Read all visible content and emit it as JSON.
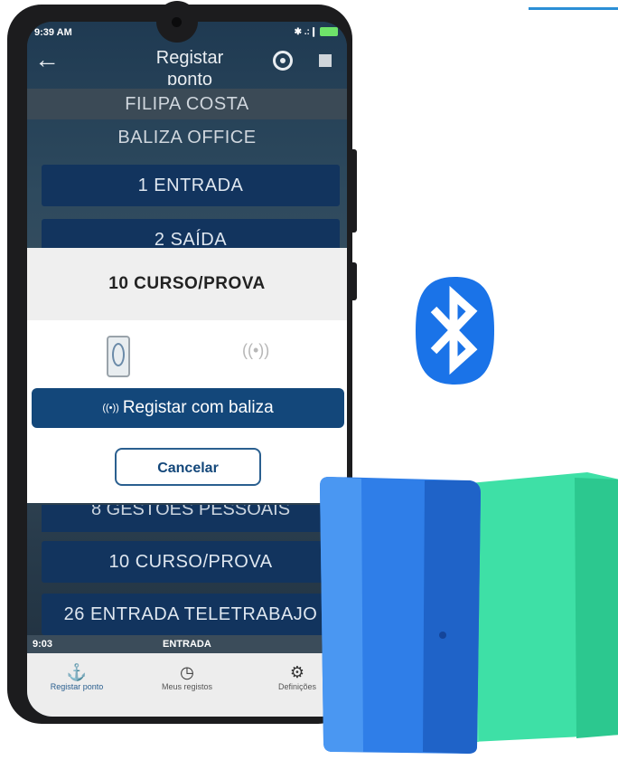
{
  "status": {
    "time": "9:39 AM",
    "signal": "✱ .:❙"
  },
  "appbar": {
    "title": "Registar ponto",
    "back_icon": "arrow-left-icon"
  },
  "employee": {
    "name": "FILIPA COSTA",
    "location": "BALIZA OFFICE"
  },
  "menu": {
    "items": [
      "1  ENTRADA",
      "2  SAÍDA"
    ],
    "partial_item": "8  GESTÕES PESSOAIS",
    "lower_items": [
      "10  CURSO/PROVA",
      "26  ENTRADA TELETRABAJO"
    ]
  },
  "dialog": {
    "title": "10  CURSO/PROVA",
    "primary_label": "Registar com baliza",
    "primary_icon_glyph": "((•))",
    "cancel_label": "Cancelar",
    "signal_glyph": "((•))"
  },
  "status_line": {
    "time": "9:03",
    "type": "ENTRADA"
  },
  "bottom_nav": [
    {
      "label": "Registar ponto",
      "icon": "⚓"
    },
    {
      "label": "Meus registos",
      "icon": "◷"
    },
    {
      "label": "Definições",
      "icon": "⚙"
    }
  ],
  "colors": {
    "primary": "#13477a",
    "item_bg": "#12345e",
    "bluetooth": "#1a73e8",
    "beacon_blue": "#2f7ee8",
    "beacon_green": "#3fe0a8"
  }
}
